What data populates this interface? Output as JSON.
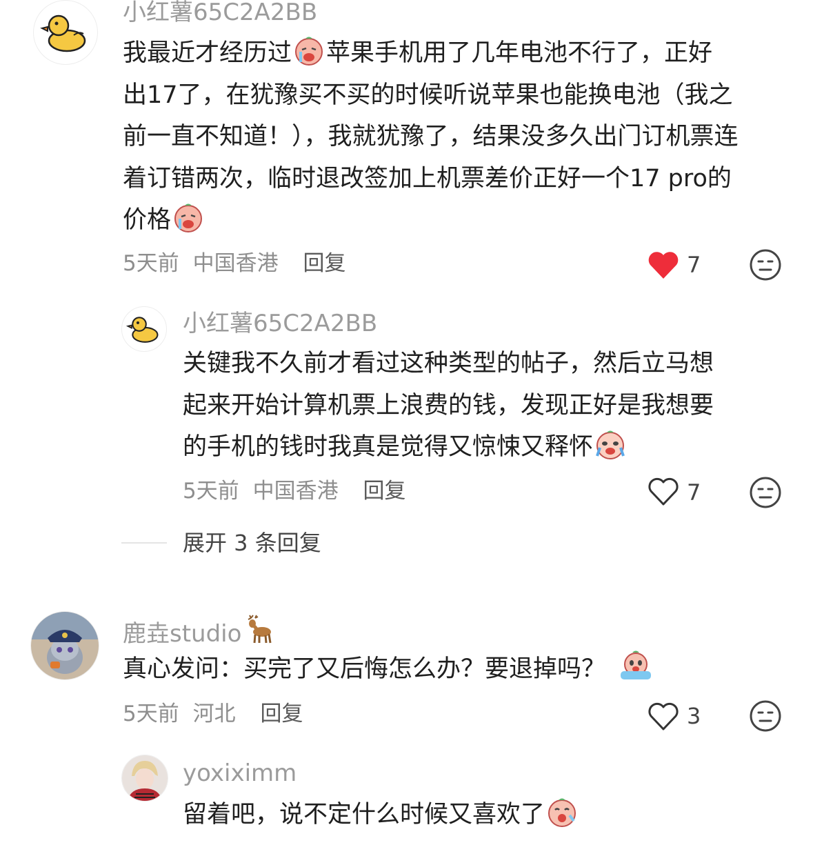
{
  "comments": [
    {
      "username": "小红薯65C2A2BB",
      "lines": [
        "我最近才经历过",
        "苹果手机用了几年电池不行了，正好",
        "出17了，在犹豫买不买的时候听说苹果也能换电池（我之",
        "前一直不知道！），我就犹豫了，结果没多久出门订机票连",
        "着订错两次，临时退改签加上机票差价正好一个17 pro的",
        "价格"
      ],
      "time": "5天前",
      "location": "中国香港",
      "reply": "回复",
      "likes": "7",
      "liked": true
    },
    {
      "username": "小红薯65C2A2BB",
      "lines": [
        "关键我不久前才看过这种类型的帖子，然后立马想",
        "起来开始计算机票上浪费的钱，发现正好是我想要",
        "的手机的钱时我真是觉得又惊悚又释怀"
      ],
      "time": "5天前",
      "location": "中国香港",
      "reply": "回复",
      "likes": "7",
      "liked": false
    },
    {
      "username": "鹿垚studio",
      "lines": [
        "真心发问：买完了又后悔怎么办？要退掉吗？"
      ],
      "time": "5天前",
      "location": "河北",
      "reply": "回复",
      "likes": "3",
      "liked": false
    },
    {
      "username": "yoxiximm",
      "lines": [
        "留着吧，说不定什么时候又喜欢了"
      ]
    }
  ],
  "expand_replies": "展开 3 条回复",
  "colors": {
    "heart_red": "#ee2d3a",
    "meta_gray": "#8e8e8e",
    "name_gray": "#9b9b9b"
  }
}
